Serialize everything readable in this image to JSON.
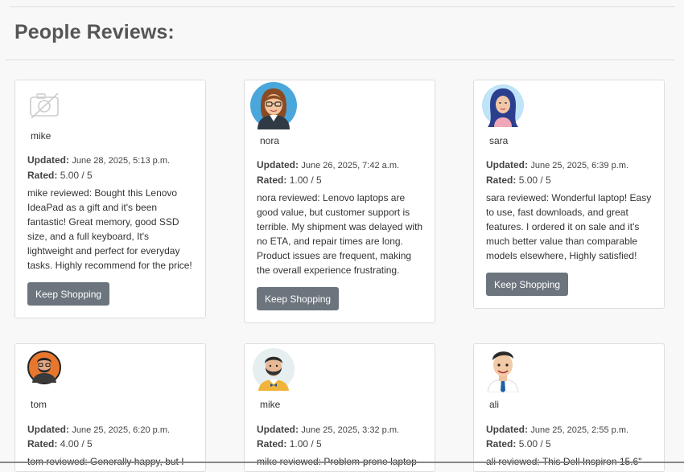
{
  "page": {
    "title": "People Reviews:"
  },
  "labels": {
    "updated": "Updated:",
    "rated": "Rated:",
    "button": "Keep Shopping"
  },
  "reviews": [
    {
      "user": "mike",
      "updated": "June 28, 2025, 5:13 p.m.",
      "rating": "5.00 / 5",
      "text": "mike reviewed: Bought this Lenovo IdeaPad as a gift and it's been fantastic! Great memory, good SSD size, and a full keyboard, It's lightweight and perfect for everyday tasks. Highly recommend for the price!",
      "avatar": "no-photo-icon"
    },
    {
      "user": "nora",
      "updated": "June 26, 2025, 7:42 a.m.",
      "rating": "1.00 / 5",
      "text": "nora reviewed: Lenovo laptops are good value, but customer support is terrible. My shipment was delayed with no ETA, and repair times are long. Product issues are frequent, making the overall experience frustrating.",
      "avatar": "woman-glasses-avatar"
    },
    {
      "user": "sara",
      "updated": "June 25, 2025, 6:39 p.m.",
      "rating": "5.00 / 5",
      "text": "sara reviewed: Wonderful laptop! Easy to use, fast downloads, and great features. I ordered it on sale and it's much better value than comparable models elsewhere, Highly satisfied!",
      "avatar": "woman-hijab-avatar"
    },
    {
      "user": "tom",
      "updated": "June 25, 2025, 6:20 p.m.",
      "rating": "4.00 / 5",
      "text": "tom reviewed: Generally happy, but I",
      "avatar": "man-beard-avatar"
    },
    {
      "user": "mike",
      "updated": "June 25, 2025, 3:32 p.m.",
      "rating": "1.00 / 5",
      "text": "mike reviewed: Problem-prone laptop",
      "avatar": "man-bowtie-avatar"
    },
    {
      "user": "ali",
      "updated": "June 25, 2025, 2:55 p.m.",
      "rating": "5.00 / 5",
      "text": "ali reviewed: This Dell Inspiron 15.6\"",
      "avatar": "man-tie-avatar"
    }
  ]
}
